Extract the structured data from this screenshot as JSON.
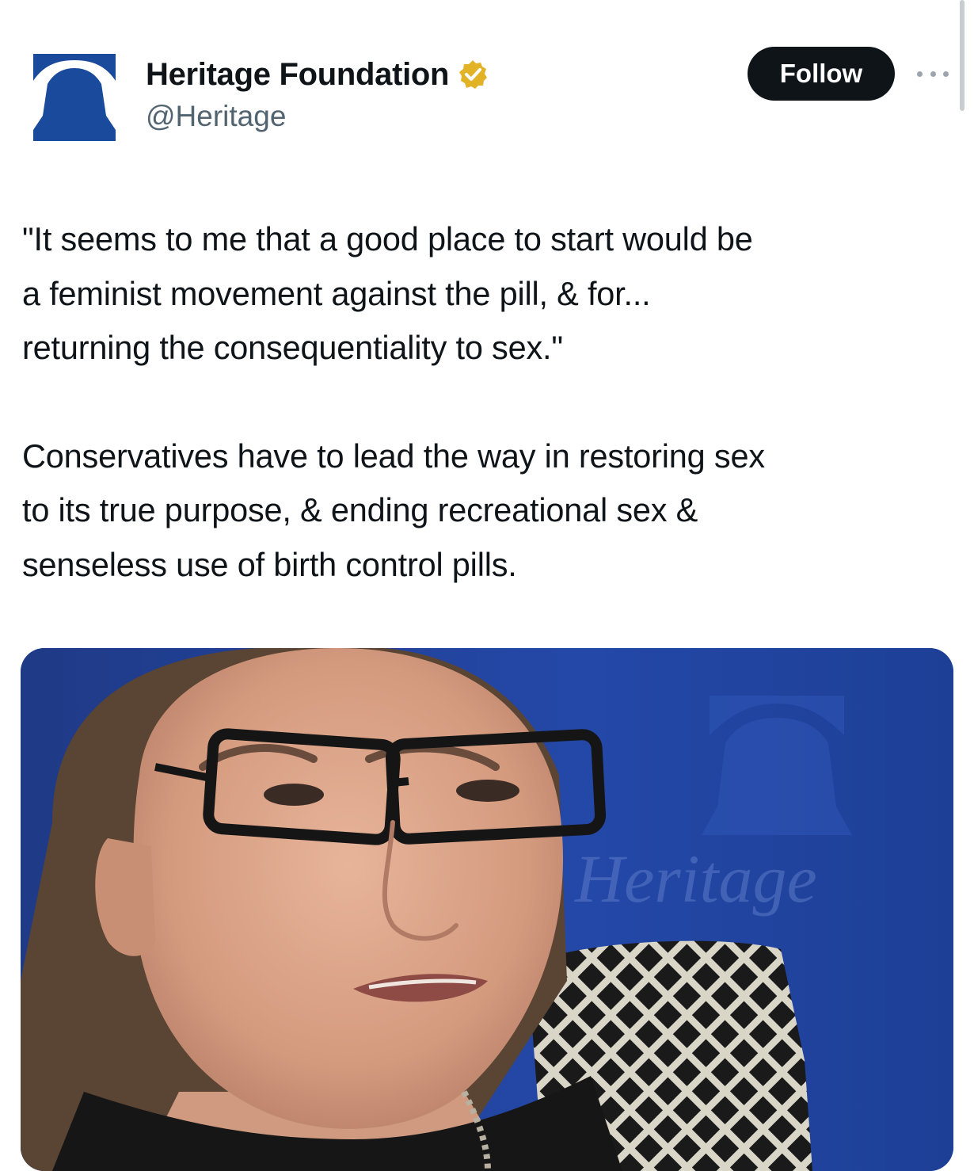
{
  "account": {
    "display_name": "Heritage Foundation",
    "handle": "@Heritage",
    "verified": true,
    "avatar_icon": "heritage-bell-logo-icon",
    "brand_color": "#1a4a9c",
    "badge_color": "#e2b227"
  },
  "actions": {
    "follow_label": "Follow",
    "more_icon": "more-options-icon"
  },
  "tweet": {
    "paragraphs": [
      "\"It seems to me that a good place to start would be\na feminist movement against the pill, & for...\nreturning the consequentiality to sex.\"",
      "Conservatives have to lead the way in restoring sex\nto its true purpose, & ending recreational sex &\nsenseless use of birth control pills."
    ]
  },
  "media": {
    "type": "video-still",
    "watermark_text": "Heritage"
  }
}
